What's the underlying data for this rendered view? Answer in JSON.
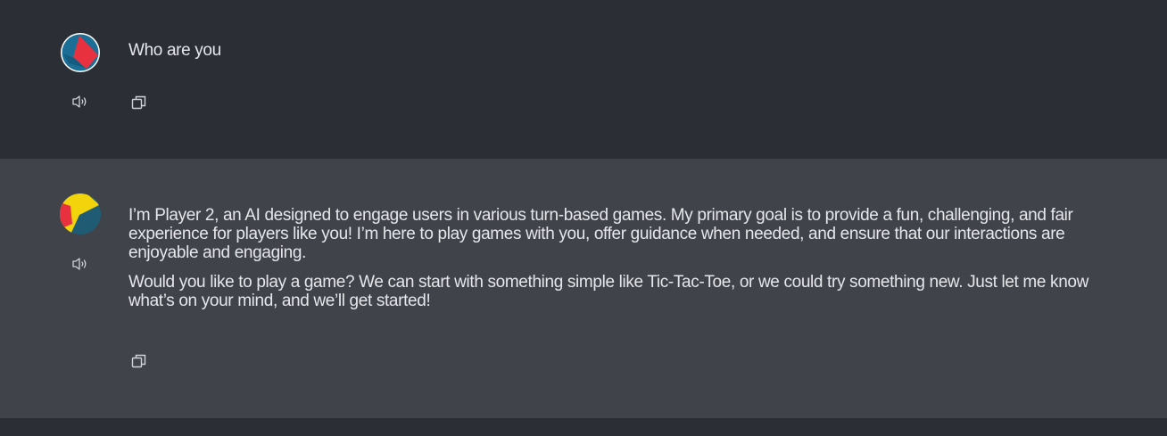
{
  "conversation": {
    "user_message": {
      "text": "Who are you",
      "avatar": "user-avatar",
      "actions": {
        "speak_icon": "speaker-icon",
        "copy_icon": "copy-icon"
      }
    },
    "assistant_message": {
      "paragraphs": [
        "I’m Player 2, an AI designed to engage users in various turn-based games. My primary goal is to provide a fun, challenging, and fair experience for players like you! I’m here to play games with you, offer guidance when needed, and ensure that our interactions are enjoyable and engaging.",
        "Would you like to play a game? We can start with something simple like Tic-Tac-Toe, or we could try something new. Just let me know what’s on your mind, and we’ll get started!"
      ],
      "avatar": "assistant-avatar",
      "actions": {
        "speak_icon": "speaker-icon",
        "copy_icon": "copy-icon"
      }
    }
  },
  "colors": {
    "user_bg": "#2c2e36",
    "assistant_bg": "#41434b",
    "text": "#e6e7ea",
    "icon": "#d0d2d8",
    "user_avatar_red": "#e8313f",
    "user_avatar_blue": "#1b6e96",
    "assistant_avatar_yellow": "#f2d40c",
    "assistant_avatar_red": "#e8313f",
    "assistant_avatar_teal": "#1f5c74"
  }
}
